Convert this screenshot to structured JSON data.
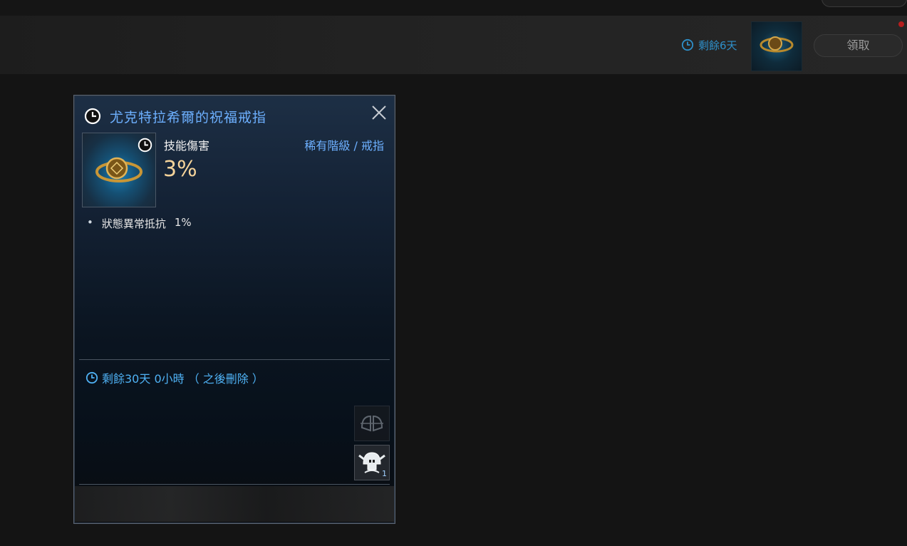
{
  "reward_bar": {
    "remaining_text": "剩餘6天",
    "claim_button": "領取"
  },
  "tooltip": {
    "title": "尤克特拉希爾的祝福戒指",
    "main_stat_label": "技能傷害",
    "main_stat_value": "3%",
    "grade": "稀有階級 / 戒指",
    "sub_stat_name": "狀態異常抵抗",
    "sub_stat_value": "1%",
    "expire_text": "剩餘30天 0小時 （ 之後刪除 ）",
    "slot_badge": "1"
  },
  "colors": {
    "title_blue": "#6db0ff",
    "value_gold": "#f6d49a",
    "expire_blue": "#4fb2f5",
    "remain_blue": "#2e8fc9"
  }
}
